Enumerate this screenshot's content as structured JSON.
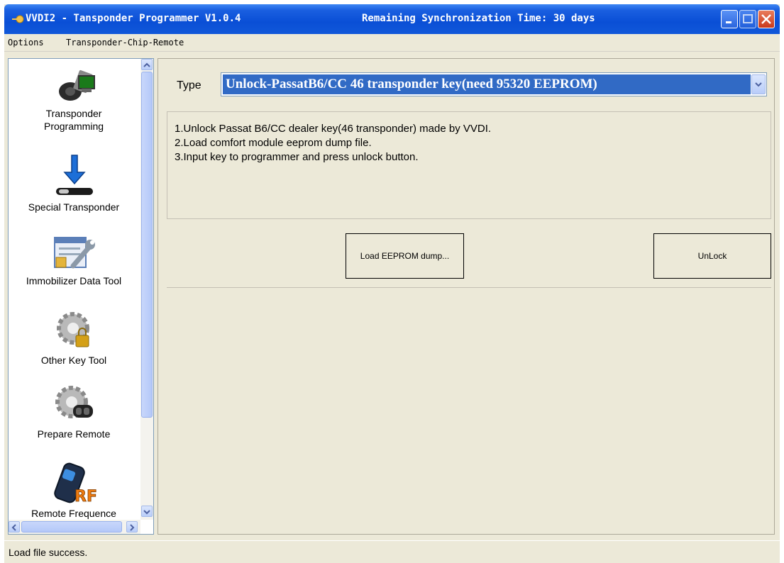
{
  "window": {
    "title": "VVDI2 - Tansponder Programmer V1.0.4",
    "sync_label": "Remaining Synchronization Time: 30 days"
  },
  "menu": {
    "items": [
      "Options",
      "Transponder-Chip-Remote"
    ]
  },
  "sidebar": {
    "items": [
      {
        "label_line1": "Transponder",
        "label_line2": "Programming",
        "icon": "key-computer-icon"
      },
      {
        "label": "Special Transponder",
        "icon": "download-transponder-icon"
      },
      {
        "label": "Immobilizer Data Tool",
        "icon": "wrench-window-icon"
      },
      {
        "label": "Other Key Tool",
        "icon": "gear-lock-icon"
      },
      {
        "label": "Prepare Remote",
        "icon": "gear-remote-icon"
      },
      {
        "label": "Remote Frequence",
        "icon": "remote-rf-icon"
      }
    ]
  },
  "main": {
    "type_label": "Type",
    "type_value": "Unlock-PassatB6/CC 46 transponder key(need 95320 EEPROM)",
    "description": [
      "1.Unlock Passat B6/CC dealer key(46 transponder) made by VVDI.",
      "2.Load comfort module eeprom dump file.",
      "3.Input key to programmer and press unlock button."
    ],
    "load_button": "Load EEPROM dump...",
    "unlock_button": "UnLock"
  },
  "status": {
    "text": "Load file success."
  },
  "colors": {
    "title_bar": "#0a4fd6",
    "selection": "#316ac5",
    "window_bg": "#ece9d8",
    "close_button": "#c9391b"
  }
}
